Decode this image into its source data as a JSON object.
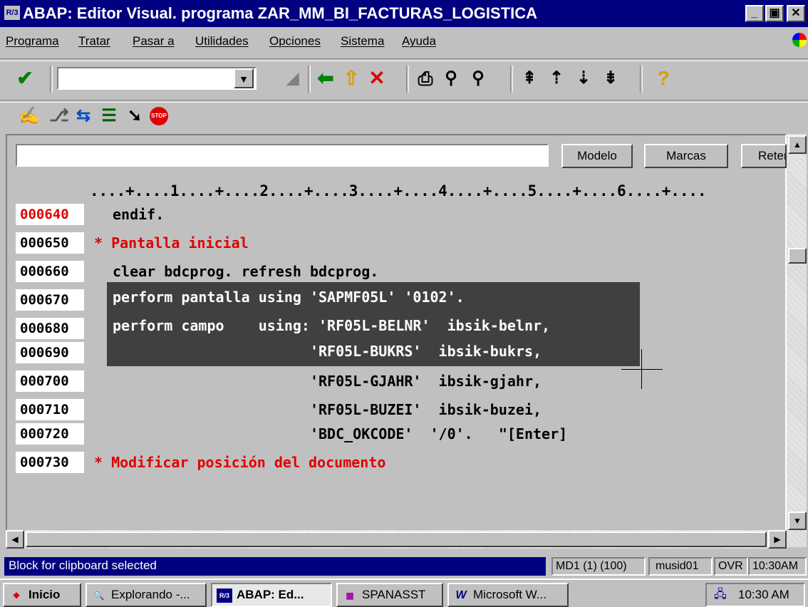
{
  "window": {
    "title": "ABAP: Editor Visual. programa ZAR_MM_BI_FACTURAS_LOGISTICA",
    "icon_label": "R/3",
    "controls": {
      "minimize": "_",
      "maximize": "▣",
      "close": "✕"
    }
  },
  "menu": [
    "Programa",
    "Tratar",
    "Pasar a",
    "Utilidades",
    "Opciones",
    "Sistema",
    "Ayuda"
  ],
  "toolbar": {
    "command_value": "",
    "icons": {
      "enter": "✔",
      "save": "◢",
      "back": "⬅",
      "exit": "⇧",
      "cancel": "✕",
      "print": "⎙",
      "find": "⚲",
      "find_next": "⚲",
      "first_page": "⇞",
      "prev_page": "⇡",
      "next_page": "⇣",
      "last_page": "⇟",
      "help": "?"
    }
  },
  "app_toolbar_icons": [
    "✍",
    "⎇",
    "⇆",
    "☰",
    "➘",
    "STOP"
  ],
  "editor": {
    "find_value": "",
    "buttons": [
      "Modelo",
      "Marcas",
      "Reten"
    ],
    "ruler": "....+....1....+....2....+....3....+....4....+....5....+....6....+....",
    "lines": [
      {
        "num": "000640",
        "text": "endif.",
        "num_red": true,
        "style": "normal"
      },
      {
        "num": "000650",
        "text": "* Pantalla inicial",
        "num_red": false,
        "style": "comment"
      },
      {
        "num": "000660",
        "text": "clear bdcprog. refresh bdcprog.",
        "num_red": false,
        "style": "normal"
      },
      {
        "num": "000670",
        "text": "perform pantalla using 'SAPMF05L' '0102'.",
        "num_red": false,
        "style": "selected"
      },
      {
        "num": "000680",
        "text": "perform campo    using: 'RF05L-BELNR'  ibsik-belnr,",
        "num_red": false,
        "style": "selected"
      },
      {
        "num": "000690",
        "text": "                       'RF05L-BUKRS'  ibsik-bukrs,",
        "num_red": false,
        "style": "selected"
      },
      {
        "num": "000700",
        "text": "                       'RF05L-GJAHR'  ibsik-gjahr,",
        "num_red": false,
        "style": "normal"
      },
      {
        "num": "000710",
        "text": "                       'RF05L-BUZEI'  ibsik-buzei,",
        "num_red": false,
        "style": "normal"
      },
      {
        "num": "000720",
        "text": "                       'BDC_OKCODE'  '/0'.   \"[Enter]",
        "num_red": false,
        "style": "normal"
      },
      {
        "num": "000730",
        "text": "* Modificar posición del documento",
        "num_red": false,
        "style": "comment"
      }
    ]
  },
  "status": {
    "message": "Block for clipboard selected",
    "system": "MD1 (1) (100)",
    "user": "musid01",
    "mode": "OVR",
    "time": "10:30AM"
  },
  "taskbar": {
    "start": "Inicio",
    "tasks": [
      {
        "label": "Explorando -...",
        "icon": "🔍",
        "active": false
      },
      {
        "label": "ABAP: Ed...",
        "icon": "R/3",
        "active": true
      },
      {
        "label": "SPANASST",
        "icon": "▦",
        "active": false
      },
      {
        "label": "Microsoft W...",
        "icon": "W",
        "active": false
      }
    ],
    "clock": "10:30 AM"
  },
  "colors": {
    "title_bg": "#000080",
    "line_number_red": "#e00000",
    "comment_red": "#e00000",
    "selection_bg": "#404040"
  }
}
